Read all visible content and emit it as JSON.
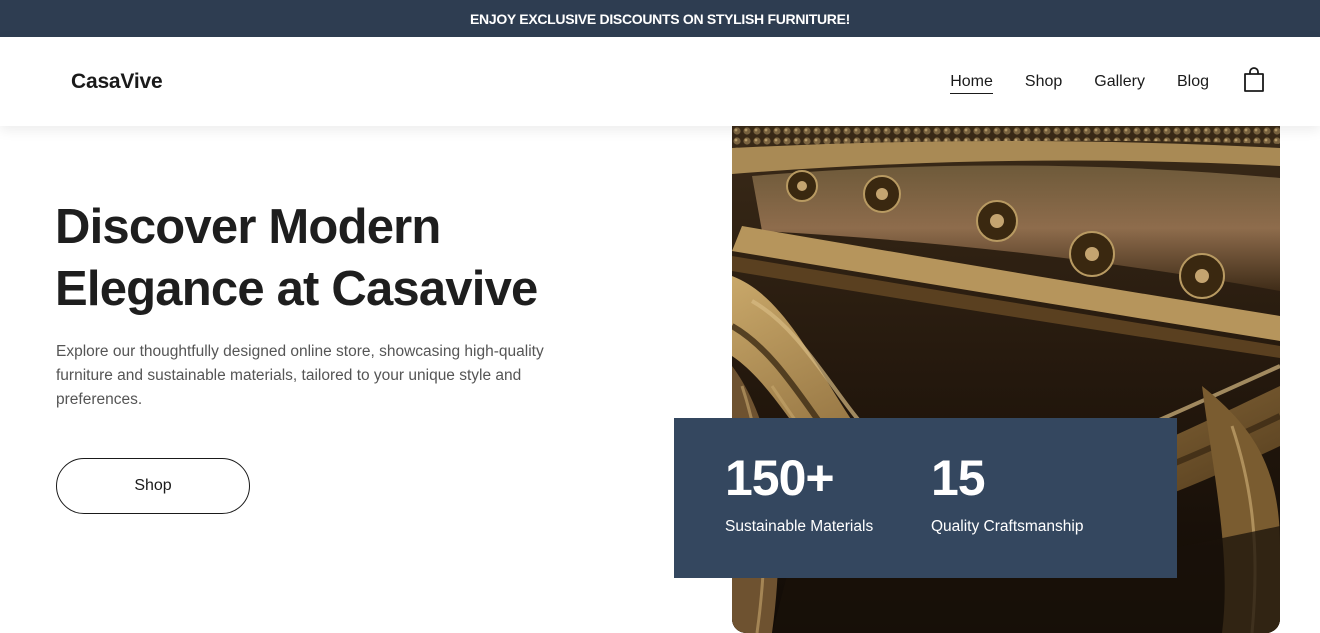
{
  "promo": {
    "text": "ENJOY EXCLUSIVE DISCOUNTS ON STYLISH FURNITURE!"
  },
  "header": {
    "logo": "CasaVive",
    "nav": [
      {
        "label": "Home",
        "active": true
      },
      {
        "label": "Shop"
      },
      {
        "label": "Gallery"
      },
      {
        "label": "Blog"
      }
    ],
    "cart_icon": "shopping-bag-icon"
  },
  "hero": {
    "title_line1": "Discover Modern",
    "title_line2": "Elegance at Casavive",
    "description": "Explore our thoughtfully designed online store, showcasing high-quality furniture and sustainable materials, tailored to your unique style and preferences.",
    "button_label": "Shop",
    "image_subject": "carved gilded antique wood furniture detail"
  },
  "stats": [
    {
      "value": "150+",
      "label": "Sustainable Materials"
    },
    {
      "value": "15",
      "label": "Quality Craftsmanship"
    }
  ],
  "colors": {
    "promo_bg": "#2e3d51",
    "stats_bg": "#34475f",
    "text_dark": "#1e1e1e",
    "text_muted": "#555555"
  }
}
